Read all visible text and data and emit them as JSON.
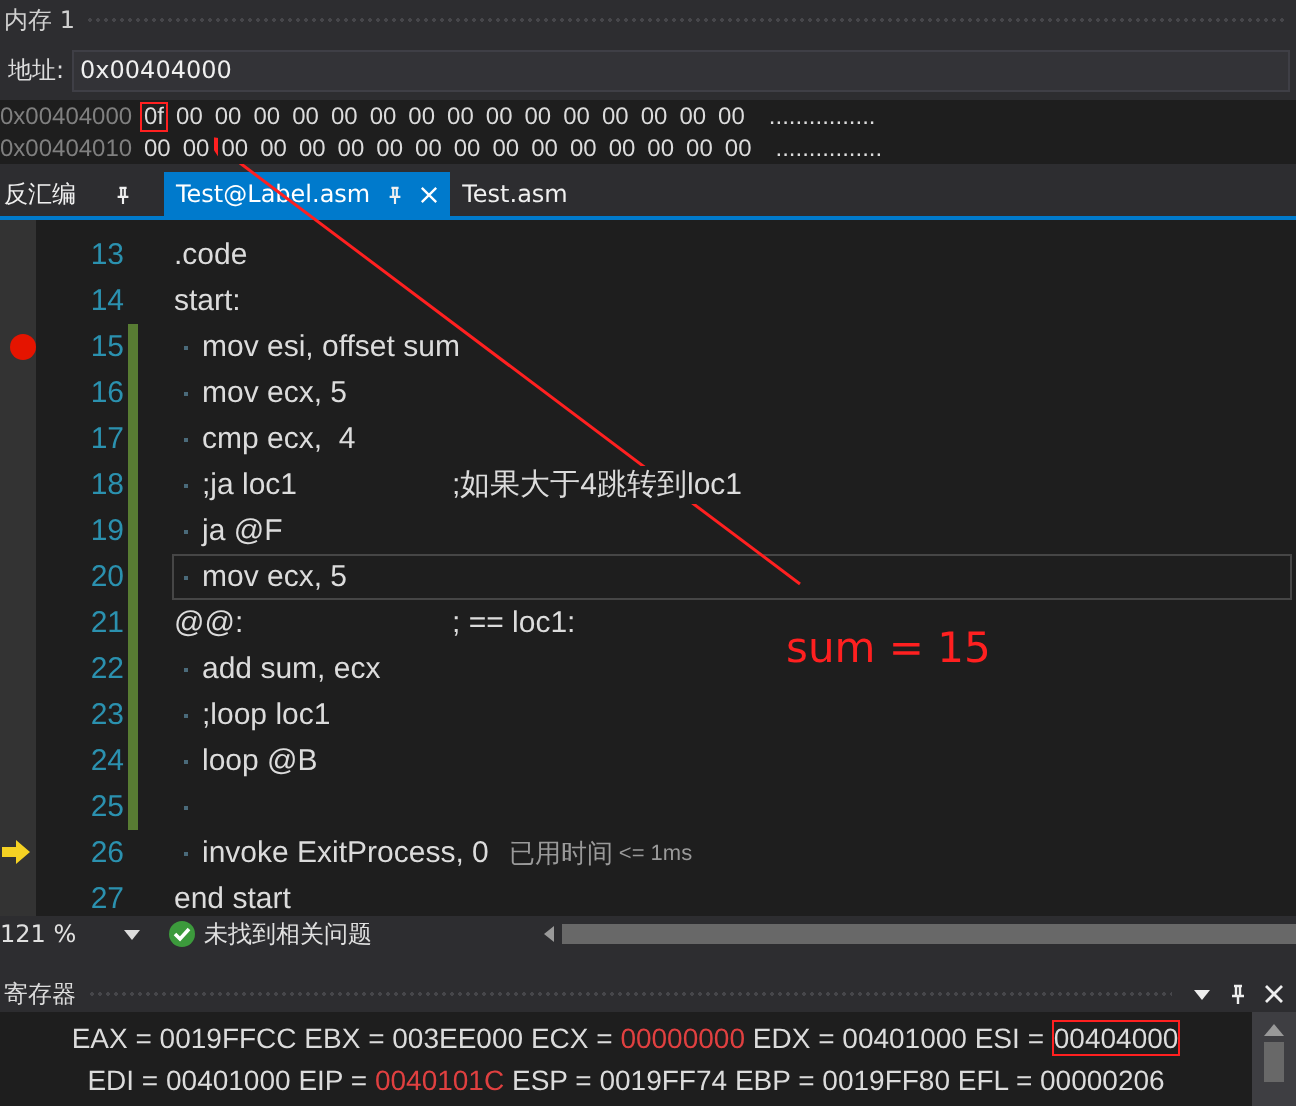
{
  "memory_window": {
    "title": "内存 1",
    "address_label": "地址:",
    "address": "0x00404000",
    "rows": [
      {
        "address": "0x00404000",
        "bytes": [
          {
            "value": "0f",
            "boxed": true
          },
          {
            "value": "00",
            "boxed": false
          },
          {
            "value": "00",
            "boxed": false
          },
          {
            "value": "00",
            "boxed": false
          },
          {
            "value": "00",
            "boxed": false
          },
          {
            "value": "00",
            "boxed": false
          },
          {
            "value": "00",
            "boxed": false
          },
          {
            "value": "00",
            "boxed": false
          },
          {
            "value": "00",
            "boxed": false
          },
          {
            "value": "00",
            "boxed": false
          },
          {
            "value": "00",
            "boxed": false
          },
          {
            "value": "00",
            "boxed": false
          },
          {
            "value": "00",
            "boxed": false
          },
          {
            "value": "00",
            "boxed": false
          },
          {
            "value": "00",
            "boxed": false
          },
          {
            "value": "00",
            "boxed": false
          }
        ],
        "ascii": "................"
      },
      {
        "address": "0x00404010",
        "bytes": [
          {
            "value": "00",
            "boxed": false
          },
          {
            "value": "00",
            "boxed": false
          },
          {
            "value": "00",
            "boxed": false
          },
          {
            "value": "00",
            "boxed": false
          },
          {
            "value": "00",
            "boxed": false
          },
          {
            "value": "00",
            "boxed": false
          },
          {
            "value": "00",
            "boxed": false
          },
          {
            "value": "00",
            "boxed": false
          },
          {
            "value": "00",
            "boxed": false
          },
          {
            "value": "00",
            "boxed": false
          },
          {
            "value": "00",
            "boxed": false
          },
          {
            "value": "00",
            "boxed": false
          },
          {
            "value": "00",
            "boxed": false
          },
          {
            "value": "00",
            "boxed": false
          },
          {
            "value": "00",
            "boxed": false
          },
          {
            "value": "00",
            "boxed": false
          }
        ],
        "ascii": "................"
      }
    ]
  },
  "tabs": [
    {
      "label": "反汇编",
      "selected": false,
      "pinned": true,
      "closable": false
    },
    {
      "label": "Test@Label.asm",
      "selected": true,
      "pinned": true,
      "closable": true
    },
    {
      "label": "Test.asm",
      "selected": false,
      "pinned": false,
      "closable": false
    }
  ],
  "editor": {
    "lines": [
      {
        "number": "13",
        "code": ".code",
        "indented": false,
        "changed": false,
        "breakpoint": false,
        "current": false,
        "caret": false
      },
      {
        "number": "14",
        "code": "start:",
        "indented": false,
        "changed": false,
        "breakpoint": false,
        "current": false,
        "caret": false
      },
      {
        "number": "15",
        "code": "mov esi, offset sum",
        "indented": true,
        "changed": true,
        "breakpoint": true,
        "current": false,
        "caret": false
      },
      {
        "number": "16",
        "code": "mov ecx, 5",
        "indented": true,
        "changed": true,
        "breakpoint": false,
        "current": false,
        "caret": false
      },
      {
        "number": "17",
        "code": "cmp ecx,  4",
        "indented": true,
        "changed": true,
        "breakpoint": false,
        "current": false,
        "caret": false
      },
      {
        "number": "18",
        "code": ";ja loc1",
        "comment": ";如果大于4跳转到loc1",
        "indented": true,
        "changed": true,
        "breakpoint": false,
        "current": false,
        "caret": false
      },
      {
        "number": "19",
        "code": "ja @F",
        "indented": true,
        "changed": true,
        "breakpoint": false,
        "current": false,
        "caret": false
      },
      {
        "number": "20",
        "code": "mov ecx, 5",
        "indented": true,
        "changed": true,
        "breakpoint": false,
        "current": false,
        "caret": true
      },
      {
        "number": "21",
        "code": "@@:",
        "comment": "; == loc1:",
        "indented": false,
        "changed": true,
        "breakpoint": false,
        "current": false,
        "caret": false
      },
      {
        "number": "22",
        "code": "add sum, ecx",
        "indented": true,
        "changed": true,
        "breakpoint": false,
        "current": false,
        "caret": false
      },
      {
        "number": "23",
        "code": ";loop loc1",
        "indented": true,
        "changed": true,
        "breakpoint": false,
        "current": false,
        "caret": false
      },
      {
        "number": "24",
        "code": "loop @B",
        "indented": true,
        "changed": true,
        "breakpoint": false,
        "current": false,
        "caret": false
      },
      {
        "number": "25",
        "indented": true,
        "changed": true,
        "breakpoint": false,
        "current": false,
        "caret": false
      },
      {
        "number": "26",
        "code": "invoke ExitProcess, 0",
        "hint": "已用时间",
        "hint_value": "<= 1ms",
        "indented": true,
        "changed": false,
        "breakpoint": false,
        "current": true,
        "caret": false
      },
      {
        "number": "27",
        "code": "end start",
        "indented": false,
        "changed": false,
        "breakpoint": false,
        "current": false,
        "caret": false
      }
    ]
  },
  "status_bar": {
    "zoom": "121 %",
    "issues": "未找到相关问题"
  },
  "annotation": {
    "text": "sum = 15"
  },
  "registers_window": {
    "title": "寄存器",
    "rows": [
      [
        {
          "name": "EAX",
          "sign": "=",
          "value": "0019FFCC",
          "changed": false,
          "boxed": false
        },
        {
          "name": "EBX",
          "sign": "=",
          "value": "003EE000",
          "changed": false,
          "boxed": false
        },
        {
          "name": "ECX",
          "sign": "=",
          "value": "00000000",
          "changed": true,
          "boxed": false
        },
        {
          "name": "EDX",
          "sign": "=",
          "value": "00401000",
          "changed": false,
          "boxed": false
        },
        {
          "name": "ESI",
          "sign": "=",
          "value": "00404000",
          "changed": false,
          "boxed": true
        }
      ],
      [
        {
          "name": "EDI",
          "sign": "=",
          "value": "00401000",
          "changed": false,
          "boxed": false
        },
        {
          "name": "EIP",
          "sign": "=",
          "value": "0040101C",
          "changed": true,
          "boxed": false
        },
        {
          "name": "ESP",
          "sign": "=",
          "value": "0019FF74",
          "changed": false,
          "boxed": false
        },
        {
          "name": "EBP",
          "sign": "=",
          "value": "0019FF80",
          "changed": false,
          "boxed": false
        },
        {
          "name": "EFL",
          "sign": "=",
          "value": "00000206",
          "changed": false,
          "boxed": false
        }
      ]
    ]
  }
}
